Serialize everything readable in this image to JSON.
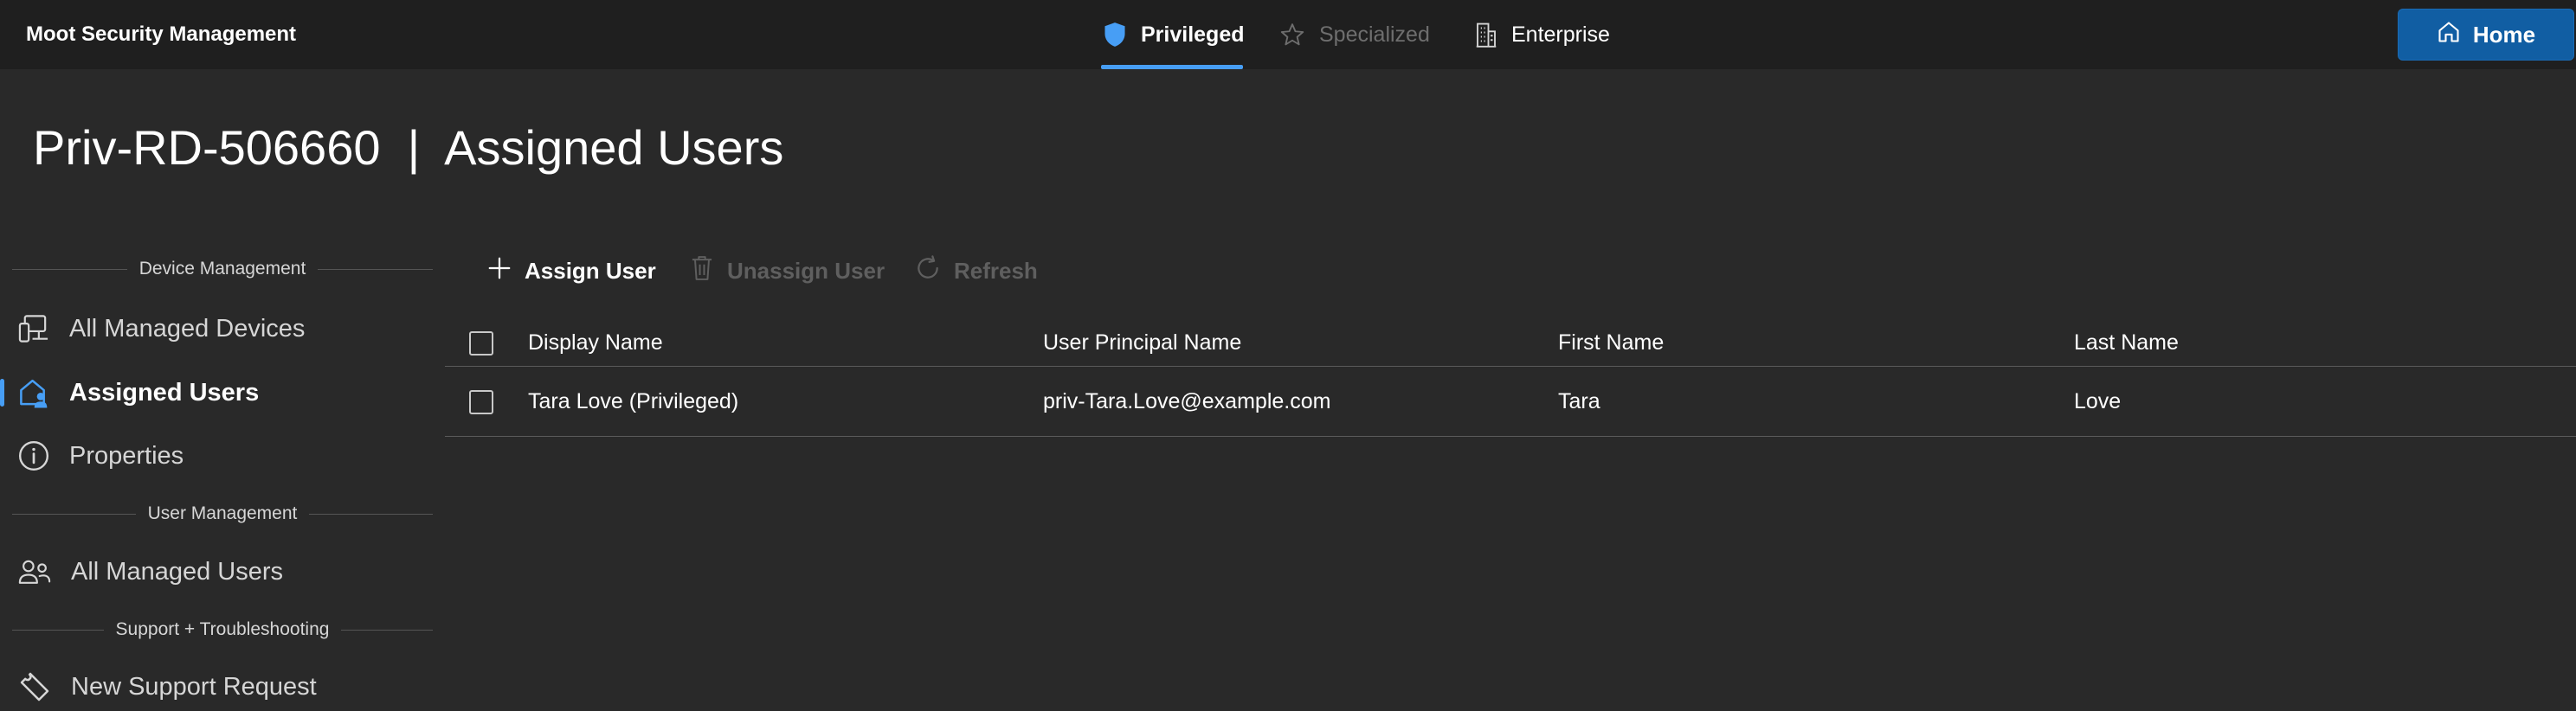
{
  "app": {
    "title": "Moot Security Management"
  },
  "tabs": [
    {
      "label": "Privileged",
      "icon": "shield-icon",
      "state": "active"
    },
    {
      "label": "Specialized",
      "icon": "star-icon",
      "state": "disabled"
    },
    {
      "label": "Enterprise",
      "icon": "building-icon",
      "state": "normal"
    }
  ],
  "home_button": {
    "label": "Home",
    "icon": "home-icon"
  },
  "page": {
    "title": "Priv-RD-506660  |  Assigned Users"
  },
  "sidebar": {
    "sections": [
      {
        "header": "Device Management",
        "items": [
          {
            "label": "All Managed Devices",
            "icon": "devices-icon",
            "active": false
          },
          {
            "label": "Assigned Users",
            "icon": "home-person-icon",
            "active": true
          },
          {
            "label": "Properties",
            "icon": "info-icon",
            "active": false
          }
        ]
      },
      {
        "header": "User Management",
        "items": [
          {
            "label": "All Managed Users",
            "icon": "people-icon",
            "active": false
          }
        ]
      },
      {
        "header": "Support + Troubleshooting",
        "items": [
          {
            "label": "New Support Request",
            "icon": "ticket-icon",
            "active": false
          }
        ]
      }
    ]
  },
  "commands": {
    "assign": {
      "label": "Assign User",
      "icon": "add-icon",
      "enabled": true
    },
    "unassign": {
      "label": "Unassign User",
      "icon": "delete-icon",
      "enabled": false
    },
    "refresh": {
      "label": "Refresh",
      "icon": "refresh-icon",
      "enabled": false
    }
  },
  "grid": {
    "columns": [
      "Display Name",
      "User Principal Name",
      "First Name",
      "Last Name"
    ],
    "rows": [
      [
        "Tara Love (Privileged)",
        "priv-Tara.Love@example.com",
        "Tara",
        "Love"
      ]
    ]
  },
  "colors": {
    "accent": "#479ef5",
    "primary_button": "#115ea3",
    "topbar": "#1f1f1f",
    "background": "#292929",
    "disabled_text": "#6e6e6e"
  }
}
